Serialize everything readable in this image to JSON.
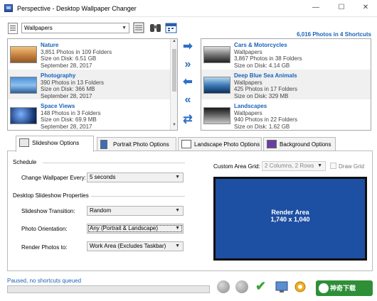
{
  "window": {
    "title": "Perspective - Desktop Wallpaper Changer",
    "minimize_glyph": "—",
    "maximize_glyph": "☐",
    "close_glyph": "✕"
  },
  "toolbar": {
    "combo_value": "Wallpapers",
    "photos_summary": "6,016 Photos in 4 Shortcuts",
    "icons": [
      "list-icon",
      "notes-icon",
      "binoculars-icon",
      "calendar-icon"
    ]
  },
  "left_list": {
    "items": [
      {
        "title": "Nature",
        "line1": "3,851 Photos in 109 Folders",
        "line2": "Size on Disk: 6.51 GB",
        "line3": "September 28, 2017"
      },
      {
        "title": "Photography",
        "line1": "390 Photos in 13 Folders",
        "line2": "Size on Disk: 366 MB",
        "line3": "September 28, 2017"
      },
      {
        "title": "Space Views",
        "line1": "148 Photos in 3 Folders",
        "line2": "Size on Disk: 69.9 MB",
        "line3": "September 28, 2017"
      }
    ]
  },
  "right_list": {
    "items": [
      {
        "title": "Cars & Motorcycles",
        "line1": "Wallpapers",
        "line2": "3,867 Photos in 38 Folders",
        "line3": "Size on Disk: 4.14 GB"
      },
      {
        "title": "Deep Blue Sea Animals",
        "line1": "Wallpapers",
        "line2": "425 Photos in 17 Folders",
        "line3": "Size on Disk: 329 MB"
      },
      {
        "title": "Landscapes",
        "line1": "Wallpapers",
        "line2": "940 Photos in 22 Folders",
        "line3": "Size on Disk: 1.62 GB"
      }
    ]
  },
  "middle_buttons": [
    {
      "icon": "arrow-right-icon",
      "glyph": "➡"
    },
    {
      "icon": "double-arrow-right-icon",
      "glyph": "»"
    },
    {
      "icon": "arrow-left-icon",
      "glyph": "⬅"
    },
    {
      "icon": "double-arrow-left-icon",
      "glyph": "«"
    },
    {
      "icon": "swap-icon",
      "glyph": "⇄"
    }
  ],
  "tabs": [
    {
      "label": "Slideshow Options",
      "icon": "slideshow-icon"
    },
    {
      "label": "Portrait Photo Options",
      "icon": "portrait-icon"
    },
    {
      "label": "Landscape Photo Options",
      "icon": "landscape-icon"
    },
    {
      "label": "Background Options",
      "icon": "background-icon"
    }
  ],
  "slideshow": {
    "schedule_heading": "Schedule",
    "change_every_label": "Change Wallpaper Every:",
    "change_every_value": "5 seconds",
    "properties_heading": "Desktop Slideshow Properties",
    "transition_label": "Slideshow Transition:",
    "transition_value": "Random",
    "orientation_label": "Photo Orientation:",
    "orientation_value": "Any (Portrait & Landscape)",
    "render_to_label": "Render Photos to:",
    "render_to_value": "Work Area (Excludes Taskbar)",
    "custom_grid_label": "Custom Area Grid:",
    "custom_grid_value": "2 Columns, 2 Rows",
    "draw_grid_label": "Draw Grid",
    "render_area_title": "Render Area",
    "render_area_size": "1,740 x 1,040"
  },
  "status": {
    "text": "Paused, no shortcuts queued",
    "progress": 0,
    "brand_text": "神奇下载"
  },
  "colors": {
    "accent_blue": "#1a63b8",
    "render_area": "#1d4fa3",
    "brand_green": "#2e8f37"
  }
}
